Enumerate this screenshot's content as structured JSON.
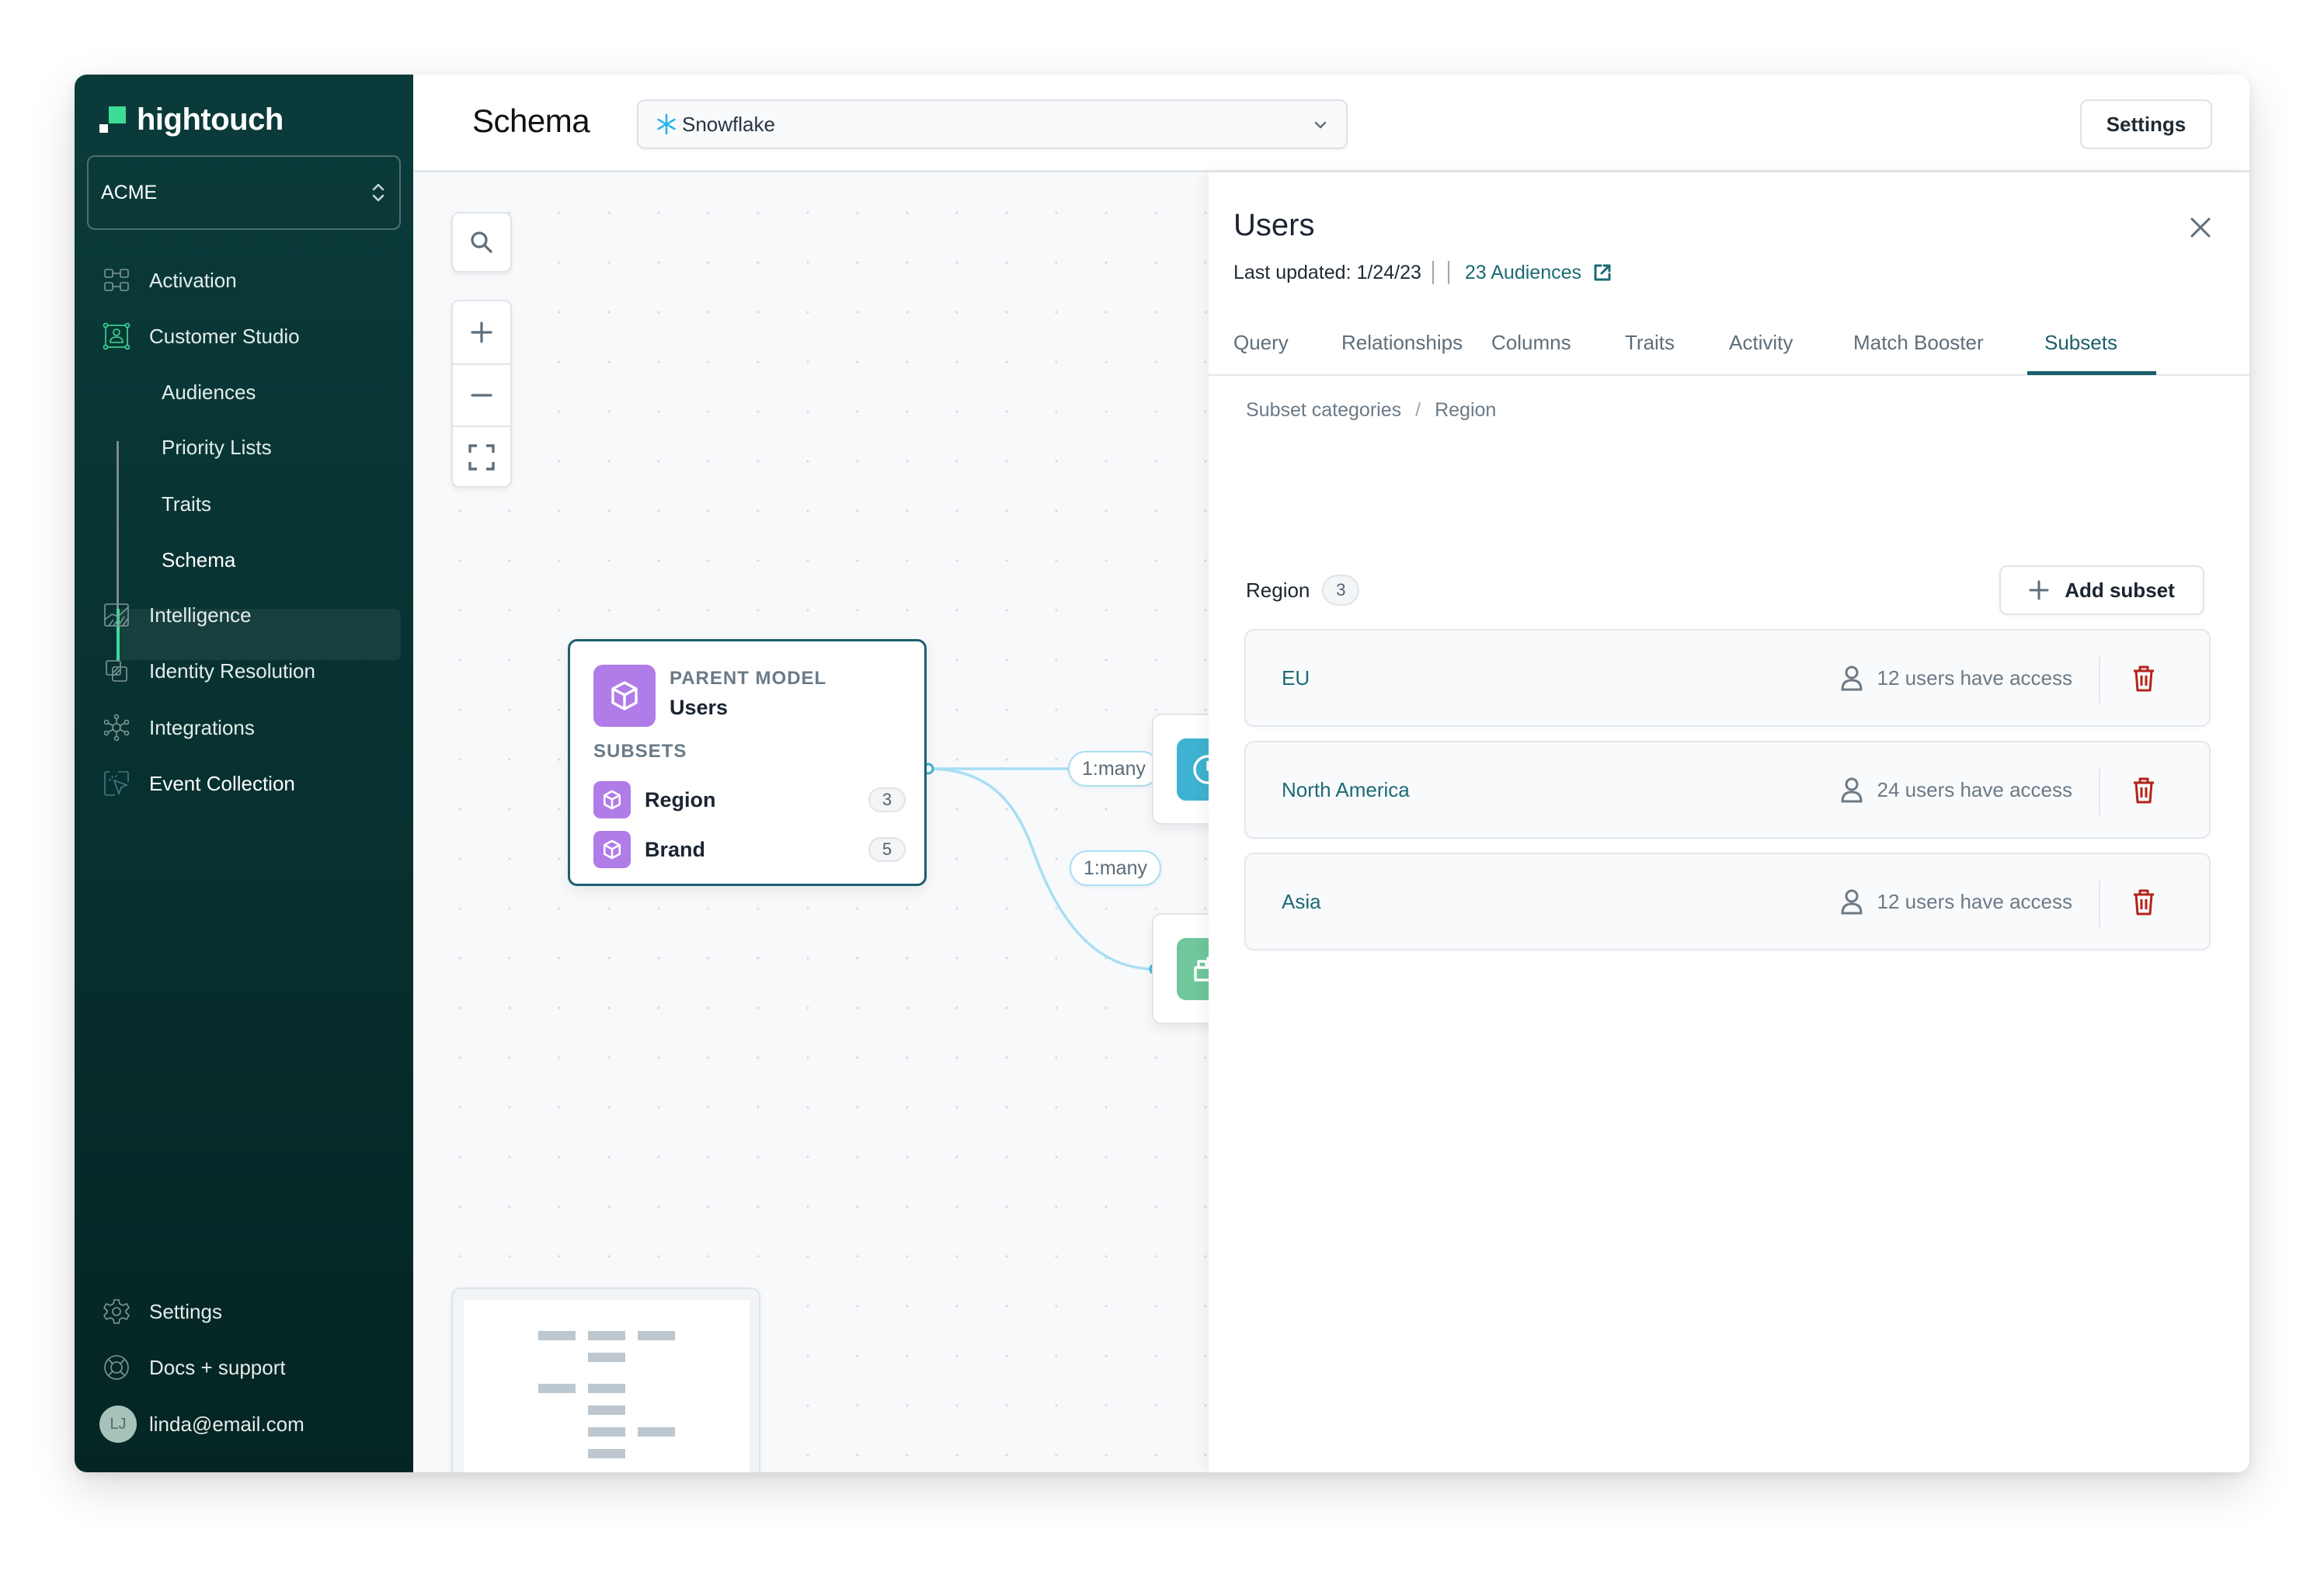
{
  "app": {
    "brand": "hightouch",
    "workspace": "ACME"
  },
  "sidebar": {
    "items": [
      {
        "label": "Activation",
        "icon": "activation-icon"
      },
      {
        "label": "Customer Studio",
        "icon": "customer-studio-icon"
      },
      {
        "label": "Audiences",
        "sub": true
      },
      {
        "label": "Priority Lists",
        "sub": true
      },
      {
        "label": "Traits",
        "sub": true
      },
      {
        "label": "Schema",
        "sub": true,
        "active": true
      },
      {
        "label": "Intelligence",
        "icon": "intelligence-icon"
      },
      {
        "label": "Identity Resolution",
        "icon": "identity-resolution-icon"
      },
      {
        "label": "Integrations",
        "icon": "integrations-icon"
      },
      {
        "label": "Event Collection",
        "icon": "event-collection-icon"
      }
    ],
    "footer": {
      "settings": "Settings",
      "docs": "Docs + support",
      "user_initials": "LJ",
      "user_email": "linda@email.com"
    }
  },
  "header": {
    "title": "Schema",
    "source": "Snowflake",
    "settings_label": "Settings"
  },
  "canvas": {
    "parent_model": {
      "eyebrow": "PARENT MODEL",
      "name": "Users",
      "subsets_label": "SUBSETS",
      "subsets": [
        {
          "name": "Region",
          "count": "3"
        },
        {
          "name": "Brand",
          "count": "5"
        }
      ]
    },
    "edges": [
      {
        "label": "1:many"
      },
      {
        "label": "1:many"
      }
    ]
  },
  "panel": {
    "title": "Users",
    "last_updated": "Last updated: 1/24/23",
    "audiences_link": "23 Audiences",
    "tabs": [
      "Query",
      "Relationships",
      "Columns",
      "Traits",
      "Activity",
      "Match Booster",
      "Subsets"
    ],
    "active_tab": "Subsets",
    "breadcrumb": [
      "Subset categories",
      "Region"
    ],
    "category": {
      "name": "Region",
      "count": "3"
    },
    "add_subset_label": "Add subset",
    "subsets": [
      {
        "name": "EU",
        "access": "12 users have access"
      },
      {
        "name": "North America",
        "access": "24 users have access"
      },
      {
        "name": "Asia",
        "access": "12 users have access"
      }
    ]
  },
  "colors": {
    "sidebar_bg": "#0a3b3a",
    "brand_green": "#3ddc97",
    "accent_teal": "#1a5f6c",
    "model_purple": "#b07ce8",
    "edge_blue": "#a9def2",
    "danger_red": "#b42318",
    "snowflake_blue": "#29b5e8"
  }
}
